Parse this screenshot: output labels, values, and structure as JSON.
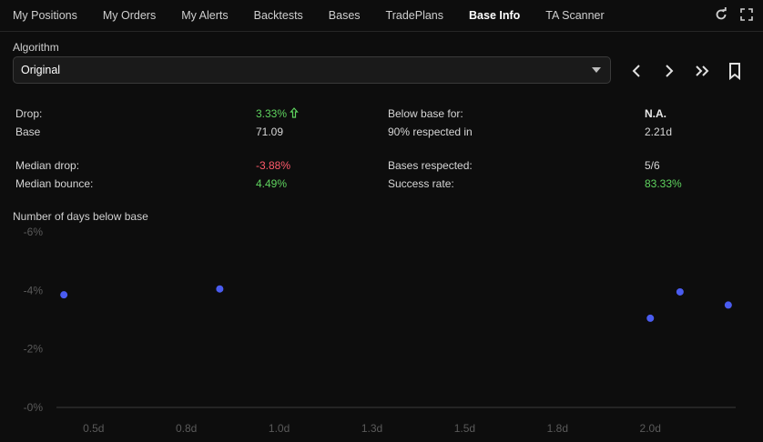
{
  "tabs": [
    {
      "label": "My Positions",
      "active": false
    },
    {
      "label": "My Orders",
      "active": false
    },
    {
      "label": "My Alerts",
      "active": false
    },
    {
      "label": "Backtests",
      "active": false
    },
    {
      "label": "Bases",
      "active": false
    },
    {
      "label": "TradePlans",
      "active": false
    },
    {
      "label": "Base Info",
      "active": true
    },
    {
      "label": "TA Scanner",
      "active": false
    }
  ],
  "topbar_icons": [
    "refresh-icon",
    "fullscreen-icon"
  ],
  "algorithm": {
    "label": "Algorithm",
    "selected": "Original"
  },
  "nav_icons": [
    "chevron-left-icon",
    "chevron-right-icon",
    "double-chevron-right-icon",
    "bookmark-icon"
  ],
  "stats": {
    "drop_label": "Drop:",
    "drop_value": "3.33%",
    "base_label": "Base",
    "base_value": "71.09",
    "below_base_label": "Below base for:",
    "below_base_value": "N.A.",
    "respected_label": "90% respected in",
    "respected_value": "2.21d",
    "median_drop_label": "Median drop:",
    "median_drop_value": "-3.88%",
    "median_bounce_label": "Median bounce:",
    "median_bounce_value": "4.49%",
    "bases_respected_label": "Bases respected:",
    "bases_respected_value": "5/6",
    "success_rate_label": "Success rate:",
    "success_rate_value": "83.33%"
  },
  "colors": {
    "positive": "#5fd35f",
    "negative": "#ff5a6a",
    "point": "#4a5cf0"
  },
  "chart_data": {
    "type": "scatter",
    "title": "Number of days below base",
    "y_tick_labels": [
      "-6%",
      "-4%",
      "-2%",
      "-0%"
    ],
    "x_tick_labels": [
      "0.5d",
      "0.8d",
      "1.0d",
      "1.3d",
      "1.5d",
      "1.8d",
      "2.0d"
    ],
    "xlim": [
      0.4,
      2.23
    ],
    "ylim": [
      0,
      -6
    ],
    "points": [
      {
        "x": 0.42,
        "y": -3.85
      },
      {
        "x": 0.84,
        "y": -4.05
      },
      {
        "x": 2.0,
        "y": -3.05
      },
      {
        "x": 2.08,
        "y": -3.95
      },
      {
        "x": 2.21,
        "y": -3.5
      }
    ]
  }
}
